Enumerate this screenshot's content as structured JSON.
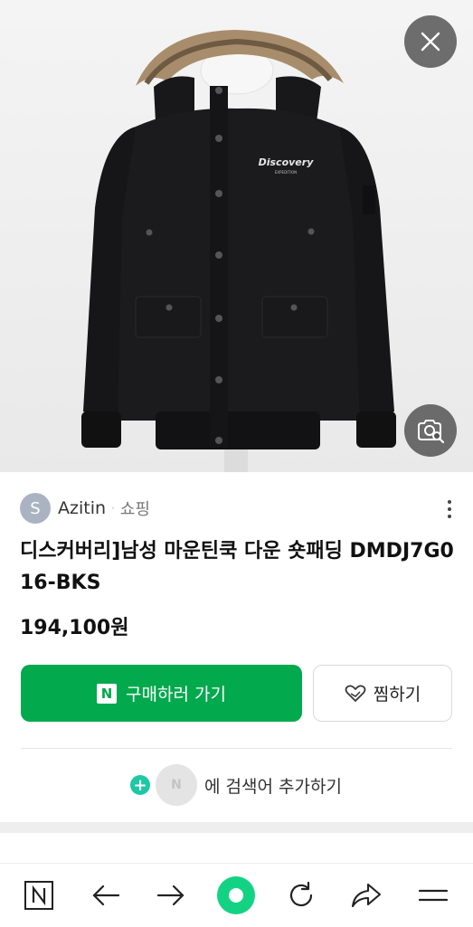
{
  "product_image": {
    "alt": "Black hooded down jacket with fur trim",
    "logo_text": "Discovery",
    "logo_subtext": "EXPEDITION"
  },
  "seller": {
    "avatar_letter": "S",
    "name": "Azitin",
    "separator": "·",
    "category": "쇼핑"
  },
  "product": {
    "title": "디스커버리]남성 마운틴쿡 다운 숏패딩 DMDJ7G016-BKS",
    "price": "194,100원"
  },
  "actions": {
    "buy_logo": "N",
    "buy_label": "구매하러 가기",
    "wish_label": "찜하기"
  },
  "add_search": {
    "plus": "+",
    "n_label": "N",
    "label": "에 검색어 추가하기"
  },
  "bottom_nav": {
    "home_letter": "N"
  },
  "colors": {
    "brand_green": "#03a94d",
    "plus_teal": "#1ec8a5",
    "center_ring": "#14d284"
  }
}
